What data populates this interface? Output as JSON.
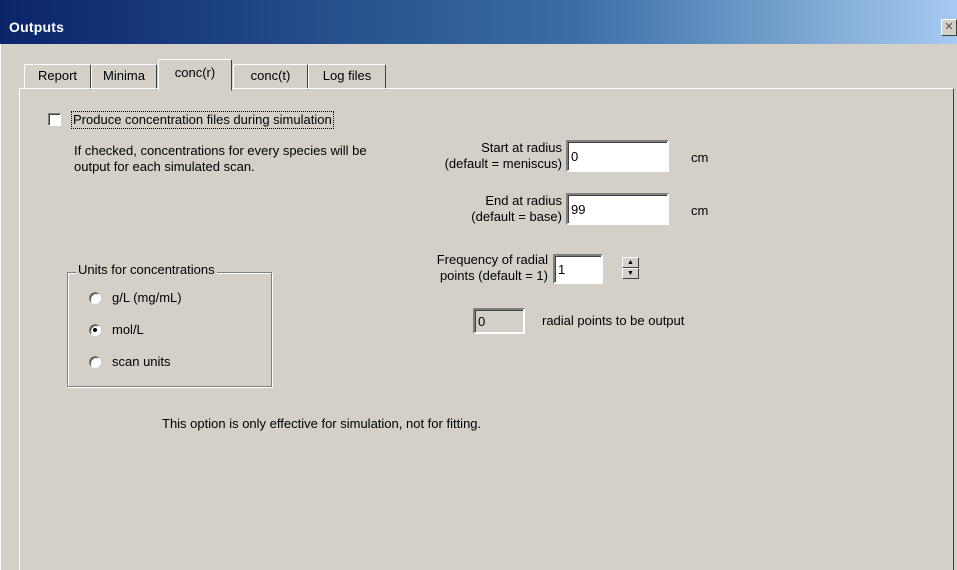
{
  "window": {
    "title": "Outputs",
    "close_glyph": "✕"
  },
  "tabs": [
    {
      "label": "Report"
    },
    {
      "label": "Minima"
    },
    {
      "label": "conc(r)"
    },
    {
      "label": "conc(t)"
    },
    {
      "label": "Log files"
    }
  ],
  "active_tab": "conc(r)",
  "produce": {
    "label": "Produce concentration files during simulation",
    "checked": false,
    "description": "If checked, concentrations for every species will be output for each simulated scan."
  },
  "units": {
    "group_label": "Units for concentrations",
    "options": [
      {
        "label": "g/L (mg/mL)",
        "selected": false
      },
      {
        "label": "mol/L",
        "selected": true
      },
      {
        "label": "scan units",
        "selected": false
      }
    ]
  },
  "start_radius": {
    "label_line1": "Start at radius",
    "label_line2": "(default = meniscus)",
    "value": "0",
    "unit": "cm"
  },
  "end_radius": {
    "label_line1": "End at radius",
    "label_line2": "(default = base)",
    "value": "99",
    "unit": "cm"
  },
  "frequency": {
    "label_line1": "Frequency of radial",
    "label_line2": "points (default = 1)",
    "value": "1",
    "up_glyph": "▲",
    "down_glyph": "▼"
  },
  "radial_points": {
    "value": "0",
    "label": "radial points to be output"
  },
  "note": "This option is only effective for simulation, not for fitting."
}
